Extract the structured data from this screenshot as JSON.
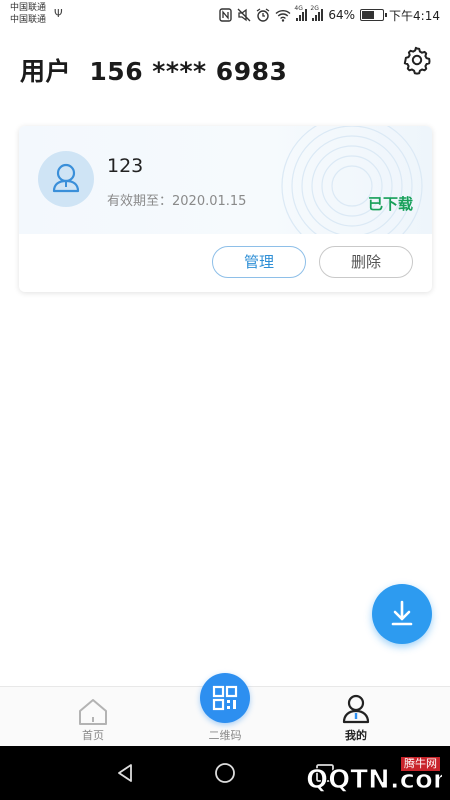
{
  "status_bar": {
    "carrier_1": "中国联通",
    "carrier_2": "中国联通",
    "network_1": "4G",
    "network_2": "2G",
    "battery_percent": "64%",
    "battery_level": 0.64,
    "time": "下午4:14",
    "icons": [
      "usb-icon",
      "nfc-icon",
      "mute-icon",
      "alarm-icon",
      "wifi-icon",
      "signal-icon",
      "battery-icon"
    ]
  },
  "header": {
    "title": "用户  156 **** 6983",
    "settings_icon": "gear-icon"
  },
  "card": {
    "name": "123",
    "validity": "有效期至：2020.01.15",
    "status": "已下载",
    "status_color": "#18a05a",
    "manage_label": "管理",
    "delete_label": "删除",
    "avatar_icon": "user-avatar-icon"
  },
  "fab": {
    "icon": "download-icon",
    "color": "#2d9bf0"
  },
  "bottom_nav": {
    "items": [
      {
        "label": "首页",
        "icon": "home-icon"
      },
      {
        "label": "二维码",
        "icon": "qr-code-icon"
      },
      {
        "label": "我的",
        "icon": "user-icon",
        "active": true
      }
    ]
  },
  "system_nav": {
    "icons": [
      "back-icon",
      "home-circle-icon",
      "recents-icon"
    ]
  },
  "watermark": {
    "text": "QQTN.com",
    "badge": "腾牛网"
  }
}
